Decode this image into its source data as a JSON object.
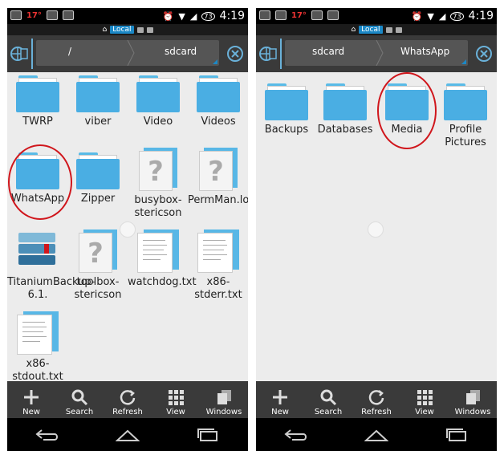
{
  "status": {
    "temp": "17°",
    "time": "4:19",
    "battery": "73"
  },
  "location_tag": "Local",
  "left": {
    "path": [
      "/",
      "sdcard"
    ],
    "items": [
      {
        "label": "TWRP",
        "type": "folder"
      },
      {
        "label": "viber",
        "type": "folder"
      },
      {
        "label": "Video",
        "type": "folder"
      },
      {
        "label": "Videos",
        "type": "folder"
      },
      {
        "label": "WhatsApp",
        "type": "folder"
      },
      {
        "label": "Zipper",
        "type": "folder"
      },
      {
        "label": "busybox-stericson",
        "type": "unknown"
      },
      {
        "label": "PermMan.log",
        "type": "unknown"
      },
      {
        "label": "TitaniumBackup-6.1.",
        "type": "app"
      },
      {
        "label": "toolbox-stericson",
        "type": "unknown"
      },
      {
        "label": "watchdog.txt",
        "type": "text"
      },
      {
        "label": "x86-stderr.txt",
        "type": "text"
      },
      {
        "label": "x86-stdout.txt",
        "type": "text"
      }
    ]
  },
  "right": {
    "path": [
      "sdcard",
      "WhatsApp"
    ],
    "items": [
      {
        "label": "Backups",
        "type": "folder"
      },
      {
        "label": "Databases",
        "type": "folder"
      },
      {
        "label": "Media",
        "type": "folder"
      },
      {
        "label": "Profile Pictures",
        "type": "folder"
      }
    ]
  },
  "bottom_actions": [
    {
      "label": "New",
      "icon": "plus-icon"
    },
    {
      "label": "Search",
      "icon": "search-icon"
    },
    {
      "label": "Refresh",
      "icon": "refresh-icon"
    },
    {
      "label": "View",
      "icon": "grid-icon"
    },
    {
      "label": "Windows",
      "icon": "windows-icon"
    }
  ],
  "colors": {
    "accent": "#1b88c6",
    "folder": "#4aaee3",
    "highlight": "#d0161c"
  }
}
